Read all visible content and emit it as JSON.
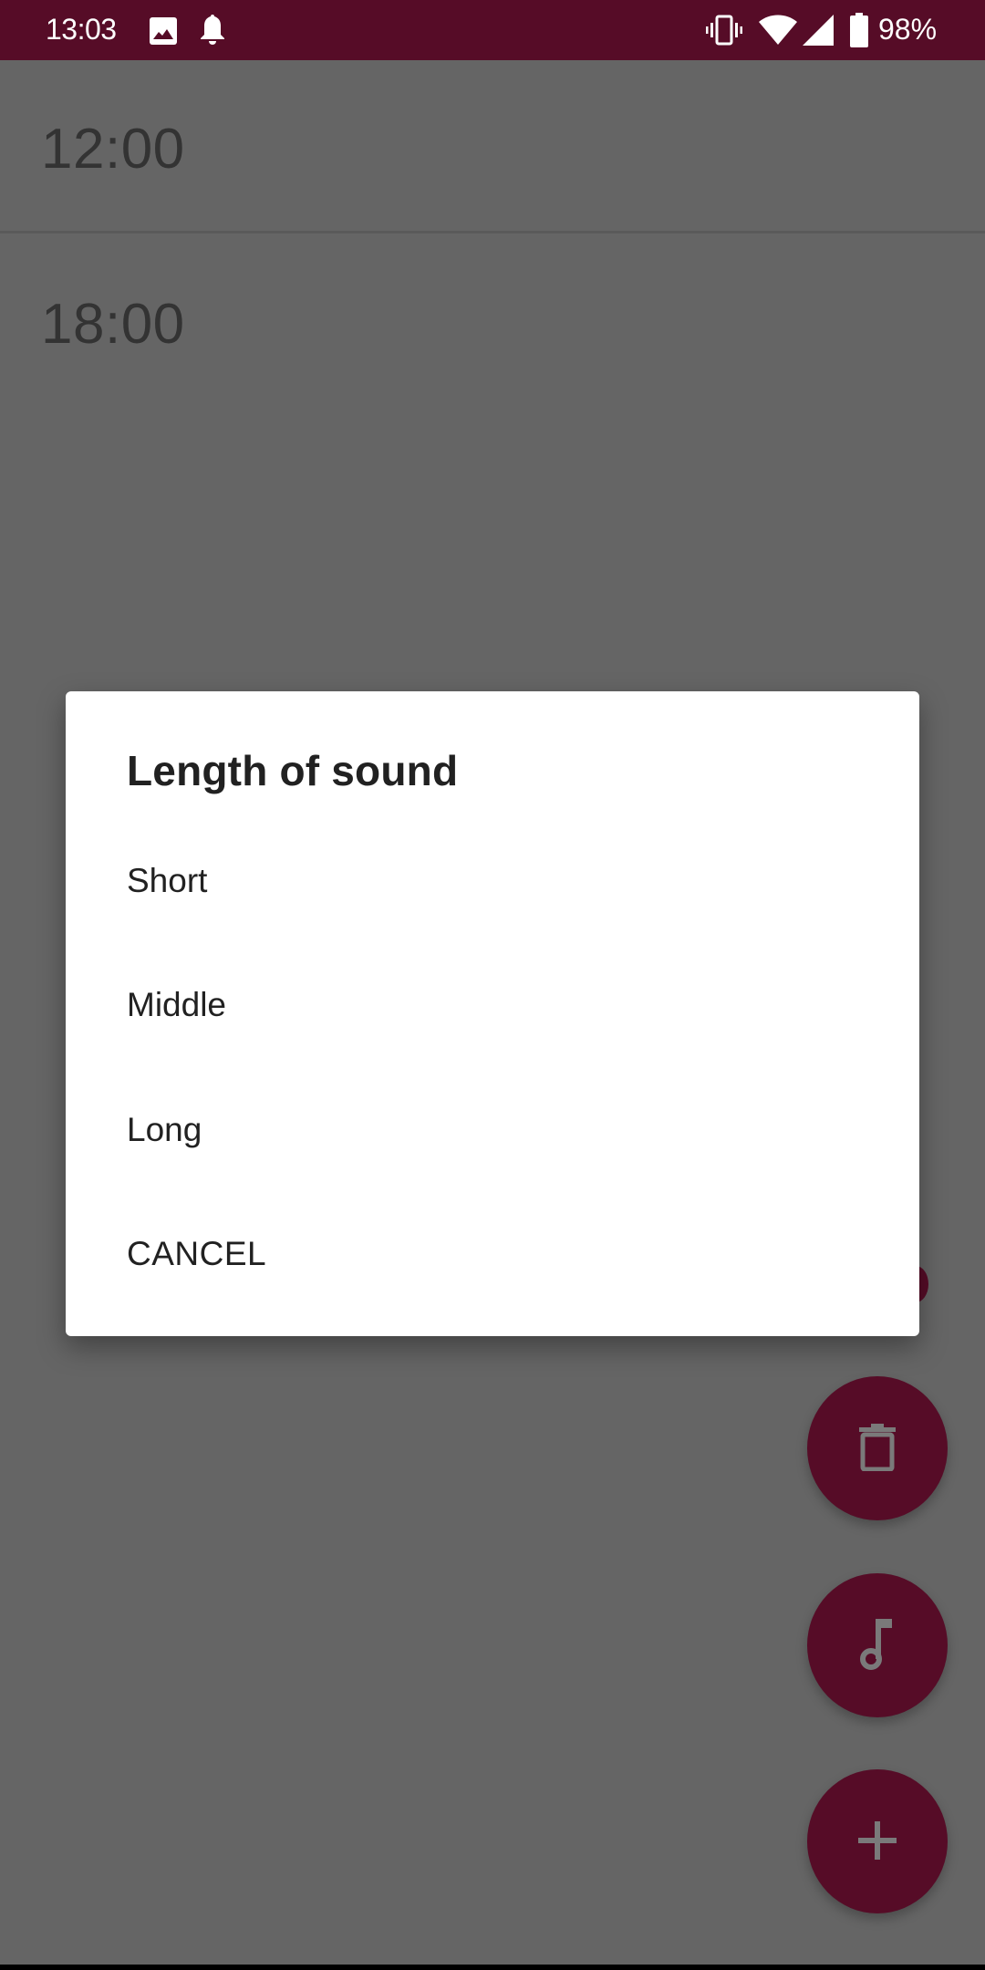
{
  "status_bar": {
    "time": "13:03",
    "left_icons": [
      "image-icon",
      "notification-bell-icon"
    ],
    "right_icons": [
      "vibrate-icon",
      "wifi-icon",
      "cell-signal-icon",
      "battery-icon"
    ],
    "battery_percent": "98%"
  },
  "alarm_list": {
    "items": [
      {
        "time": "12:00"
      },
      {
        "time": "18:00"
      }
    ]
  },
  "fabs": {
    "delete": {
      "icon": "trash-icon"
    },
    "sound": {
      "icon": "music-note-icon"
    },
    "add": {
      "icon": "plus-icon"
    }
  },
  "dialog": {
    "title": "Length of sound",
    "options": [
      {
        "label": "Short"
      },
      {
        "label": "Middle"
      },
      {
        "label": "Long"
      }
    ],
    "cancel_label": "CANCEL"
  },
  "colors": {
    "primary": "#560c27",
    "scrim_background": "#656565",
    "dialog_background": "#ffffff",
    "dialog_text": "#212121"
  }
}
